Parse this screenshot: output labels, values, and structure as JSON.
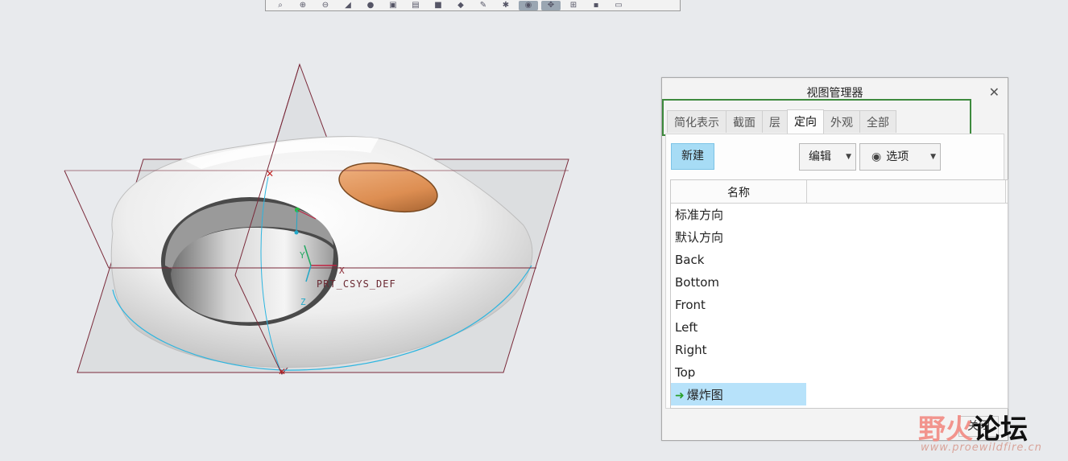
{
  "toolbar": {
    "icons": [
      "zoom-fit-icon",
      "zoom-in-icon",
      "zoom-out-icon",
      "repaint-icon",
      "shading-icon",
      "saved-views-icon",
      "view-manager-icon",
      "display-style-icon",
      "perspective-icon",
      "annotation-icon",
      "datum-icon",
      "eye-icon",
      "spin-center-icon",
      "csys-icon",
      "point-icon",
      "plane-display-icon"
    ]
  },
  "viewport": {
    "csys_label": "PRT_CSYS_DEF",
    "axis_x": "X",
    "axis_y": "Y",
    "axis_z": "Z",
    "datum_color": "#7a2a3a",
    "curve_color": "#2bb5e0",
    "ellipse_color": "#e59a5c"
  },
  "dialog": {
    "title": "视图管理器",
    "close_glyph": "✕",
    "tabs": [
      {
        "label": "简化表示",
        "active": false
      },
      {
        "label": "截面",
        "active": false
      },
      {
        "label": "层",
        "active": false
      },
      {
        "label": "定向",
        "active": true
      },
      {
        "label": "外观",
        "active": false
      },
      {
        "label": "全部",
        "active": false
      }
    ],
    "new_button": "新建",
    "edit_button": "编辑",
    "options_button": "选项",
    "list_header": "名称",
    "rows": [
      {
        "label": "标准方向",
        "selected": false
      },
      {
        "label": "默认方向",
        "selected": false
      },
      {
        "label": "Back",
        "selected": false
      },
      {
        "label": "Bottom",
        "selected": false
      },
      {
        "label": "Front",
        "selected": false
      },
      {
        "label": "Left",
        "selected": false
      },
      {
        "label": "Right",
        "selected": false
      },
      {
        "label": "Top",
        "selected": false
      },
      {
        "label": "爆炸图",
        "selected": true
      }
    ],
    "close_button": "关闭",
    "highlight_color": "#3d8a3d",
    "selected_color": "#b7e2fa"
  },
  "watermark": {
    "part1": "野火",
    "part2": "论坛",
    "url": "www.proewildfire.cn"
  }
}
